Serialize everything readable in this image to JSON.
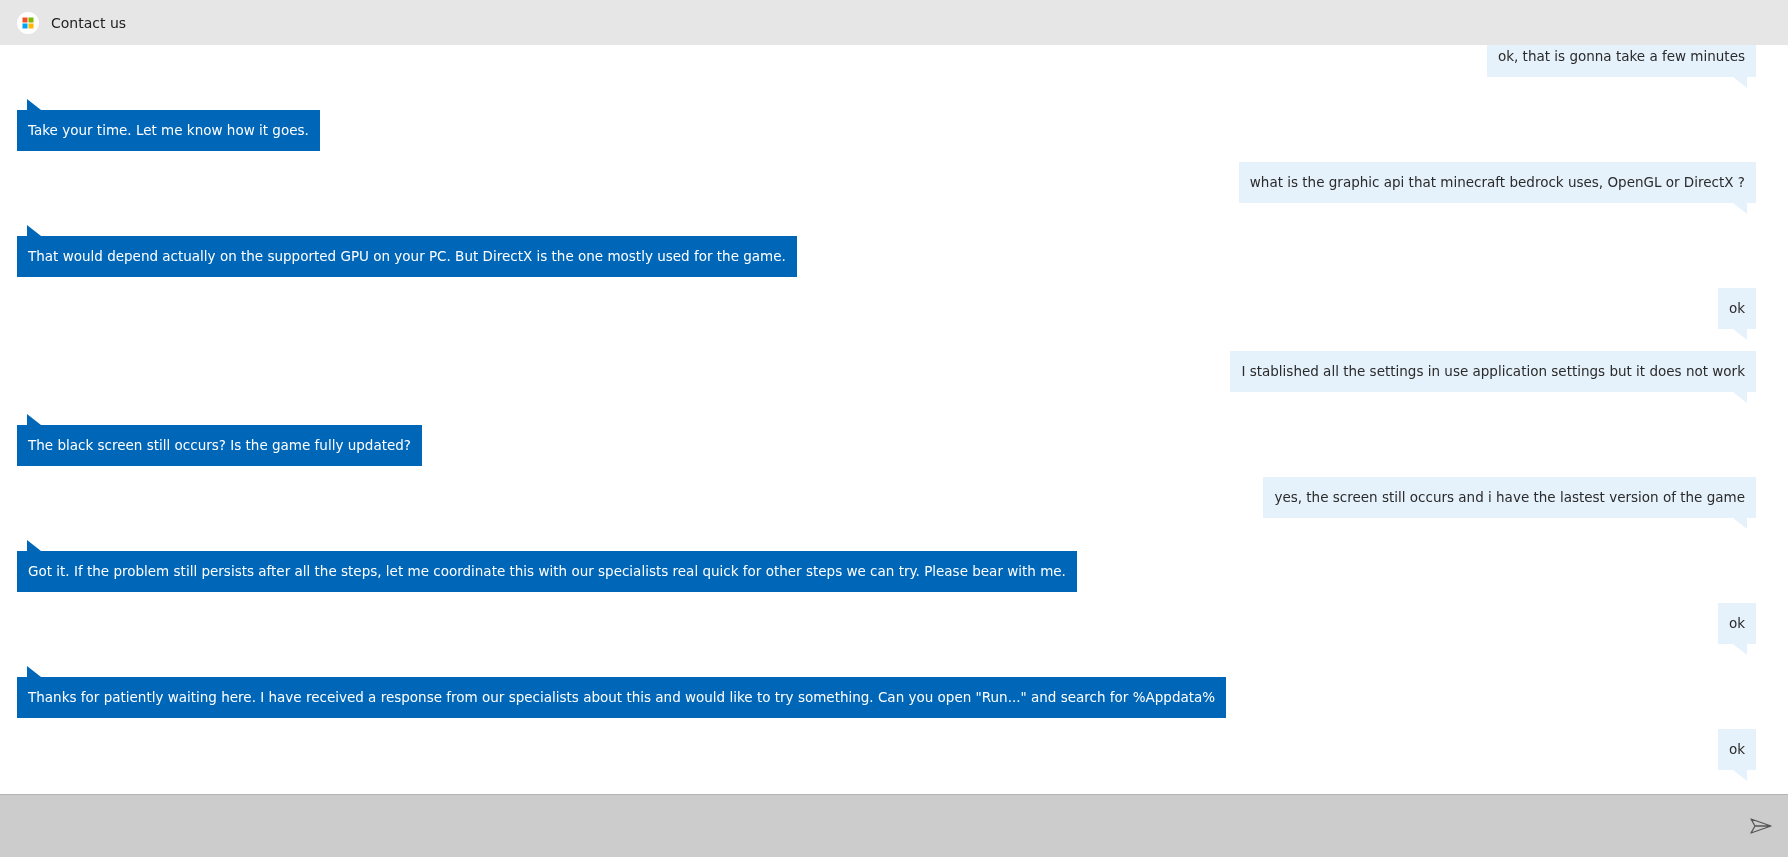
{
  "window": {
    "title": "Contact us"
  },
  "messages": [
    {
      "kind": "user",
      "text": "ok, that is gonna take a few minutes"
    },
    {
      "kind": "agent",
      "text": "Take your time. Let me know how it goes."
    },
    {
      "kind": "user",
      "text": "what is the graphic api that minecraft bedrock uses, OpenGL or DirectX ?"
    },
    {
      "kind": "agent",
      "text": "That would depend actually on the supported GPU on your PC. But DirectX is the one mostly used for the game."
    },
    {
      "kind": "user",
      "text": "ok"
    },
    {
      "kind": "user",
      "text": "I stablished all the settings in use application settings but it does not work"
    },
    {
      "kind": "agent",
      "text": "The black screen still occurs? Is the game fully updated?"
    },
    {
      "kind": "user",
      "text": "yes, the screen still occurs and i have the lastest version of the game"
    },
    {
      "kind": "agent",
      "text": "Got it. If the problem still persists after all the steps, let me coordinate this with our specialists real quick for other steps we can try. Please bear with me."
    },
    {
      "kind": "user",
      "text": "ok"
    },
    {
      "kind": "agent",
      "text": "Thanks for patiently waiting here. I have received a response from our specialists about this and would like to try something. Can you open \"Run...\" and search for %Appdata%"
    },
    {
      "kind": "user",
      "text": "ok"
    }
  ]
}
